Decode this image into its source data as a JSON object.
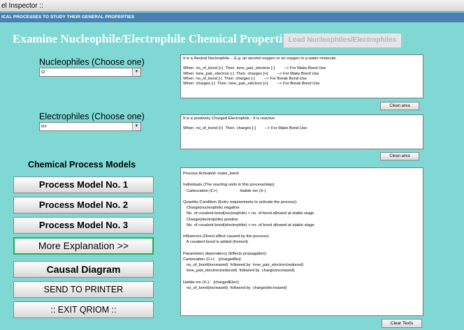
{
  "window": {
    "title": "el Inspector ::",
    "subtitle": "ICAL PROCESSES TO STUDY THEIR GENERAL PROPERTIES"
  },
  "header": {
    "heading": "Examine Nucleophile/Electrophile Chemical Properties",
    "load_button": "Load Nucleophiles/Electrophiles"
  },
  "nucleophiles": {
    "label": "Nucleophiles (Choose one)",
    "selected": "O",
    "description_lines": [
      "It is a Neutral Nucleophile -- E.g. an alcohol oxygen or an oxygen in a water molecule.",
      "",
      "When  no_of_bond [+]  Then  lone_pair_electron [-]        --> For Make Bond Use",
      "When  lone_pair_electron [-]  Then  charges [+]        --> For Make Bond Use",
      "When  no_of_bond [-]  Then  charges [-]        --> For Break Bond Use",
      "When  charges [-]  Then  lone_pair_electron [+]        --> For Break Bond Use"
    ],
    "clean_button": "Clean area"
  },
  "electrophiles": {
    "label": "Electrophiles (Choose one)",
    "selected": "H+",
    "description_lines": [
      "It is a positively Charged Electrophile - It is reactive",
      "",
      "When  no_of_bond [+]  Then  charges [-]        --> For Make Bond Use"
    ],
    "clean_button": "Clean area"
  },
  "models": {
    "heading": "Chemical Process Models",
    "buttons": [
      "Process Model No. 1",
      "Process Model No. 2",
      "Process Model No. 3"
    ],
    "more_button": "More Explanation >>",
    "causal_button": "Causal Diagram",
    "printer_button": "SEND TO PRINTER",
    "exit_button": ":: EXIT QRIOM ::"
  },
  "output": {
    "lines": [
      "Process Activated: make_bond",
      "",
      "Individuals (The reacting units in this process/step):",
      "   Carbocation (C+)                    Halide ion (X-)",
      "",
      "Quantity-Condition (Entry requirements to activate the process):",
      "   Charge(nucleophile) negative",
      "   No. of covalent bond(nucleophile) < no. of bond allowed at stable stage",
      "   Charge(electrophile) positive",
      "   No. of covalent bond(electrophile) < no. of bond allowed at stable stage",
      "",
      "Influences (Direct effect caused by the process):",
      "   A covalent bond is added (formed)",
      "",
      "Parameters dependency (Effects propagation):",
      "Carbocation (C+):   [chargedNu]:",
      "   no_of_bond(increased)  followed by  lone_pair_electron(reduced)",
      "   lone_pair_electron(reduced)  followed by  charge(increased)",
      "",
      "Halide ion (X-):   [chargedElec]:",
      "   no_of_bond(increased)  followed by  charge(decreased)"
    ],
    "clear_button": "Clear Texts"
  }
}
